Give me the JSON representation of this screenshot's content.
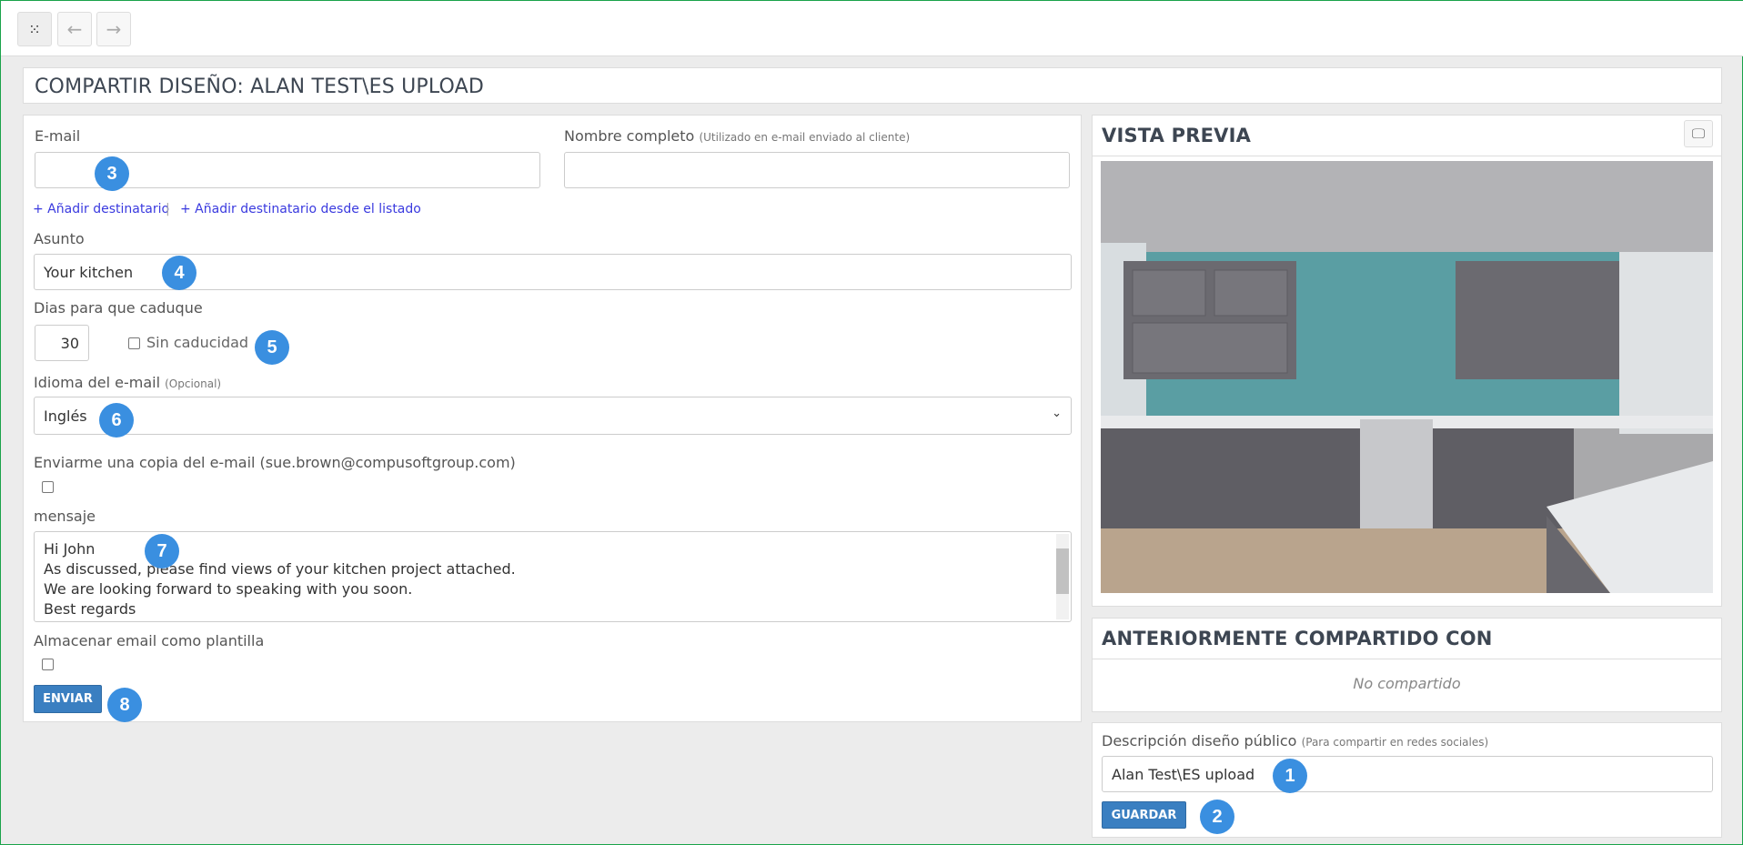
{
  "toolbar": {
    "apps_icon": "grid-icon",
    "back_icon": "arrow-left-icon",
    "forward_icon": "arrow-right-icon"
  },
  "page_title": "COMPARTIR DISEÑO: ALAN TEST\\ES UPLOAD",
  "form": {
    "email_label": "E-mail",
    "email_value": "",
    "fullname_label": "Nombre completo",
    "fullname_hint": "(Utilizado en e-mail enviado al cliente)",
    "fullname_value": "",
    "add_recipient": "+ Añadir destinatario",
    "separator": "|",
    "add_from_list": "+ Añadir destinatario desde el listado",
    "subject_label": "Asunto",
    "subject_value": "Your kitchen",
    "days_label": "Dias para que caduque",
    "days_value": "30",
    "no_expiry_label": "Sin caducidad",
    "no_expiry_checked": false,
    "language_label": "Idioma del e-mail",
    "language_hint": "(Opcional)",
    "language_value": "Inglés",
    "copy_label": "Enviarme una copia del e-mail (sue.brown@compusoftgroup.com)",
    "copy_checked": false,
    "message_label": "mensaje",
    "message_lines": [
      "Hi John",
      "As discussed, please find views of your kitchen project attached.",
      "We are looking forward to speaking with you soon.",
      "Best regards"
    ],
    "template_label": "Almacenar email como plantilla",
    "template_checked": false,
    "send_button": "ENVIAR"
  },
  "preview": {
    "title": "VISTA PREVIA",
    "monitor_icon": "monitor-icon"
  },
  "shared": {
    "title": "ANTERIORMENTE COMPARTIDO CON",
    "empty": "No compartido"
  },
  "public": {
    "label": "Descripción diseño público",
    "hint": "(Para compartir en redes sociales)",
    "value": "Alan Test\\ES upload",
    "save_button": "GUARDAR"
  },
  "badges": [
    "1",
    "2",
    "3",
    "4",
    "5",
    "6",
    "7",
    "8"
  ],
  "colors": {
    "accent": "#3a7fc1",
    "badge": "#3a8fe0",
    "link": "#3a3adf"
  }
}
